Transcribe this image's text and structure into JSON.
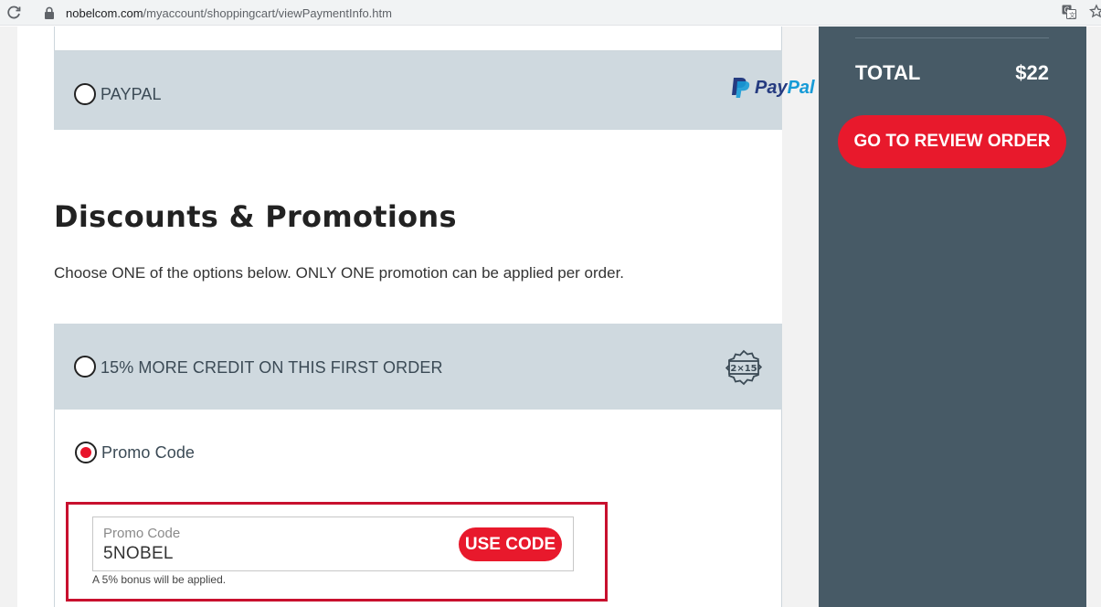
{
  "browser": {
    "url_host": "nobelcom.com",
    "url_path": "/myaccount/shoppingcart/viewPaymentInfo.htm",
    "icons": [
      "reload-icon",
      "lock-icon",
      "translate-icon",
      "star-icon"
    ]
  },
  "payment": {
    "paypal_label": "PAYPAL",
    "paypal_logo_pay": "Pay",
    "paypal_logo_pal": "Pal",
    "paypal_selected": false
  },
  "discounts": {
    "title": "Discounts & Promotions",
    "description": "Choose ONE of the options below. ONLY ONE promotion can be applied per order.",
    "options": [
      {
        "label": "15% MORE CREDIT ON THIS FIRST ORDER",
        "selected": false,
        "badge_text": "2×15"
      },
      {
        "label": "Promo Code",
        "selected": true
      }
    ],
    "promo": {
      "field_label": "Promo Code",
      "value": "5NOBEL",
      "button_label": "USE CODE",
      "hint": "A 5% bonus will be applied."
    }
  },
  "summary": {
    "total_label": "TOTAL",
    "total_value": "$22",
    "review_button": "GO TO REVIEW ORDER"
  },
  "colors": {
    "accent_red": "#e8192c",
    "sidebar_bg": "#475a66",
    "option_bg": "#cfd9df",
    "highlight_border": "#c8102e"
  }
}
